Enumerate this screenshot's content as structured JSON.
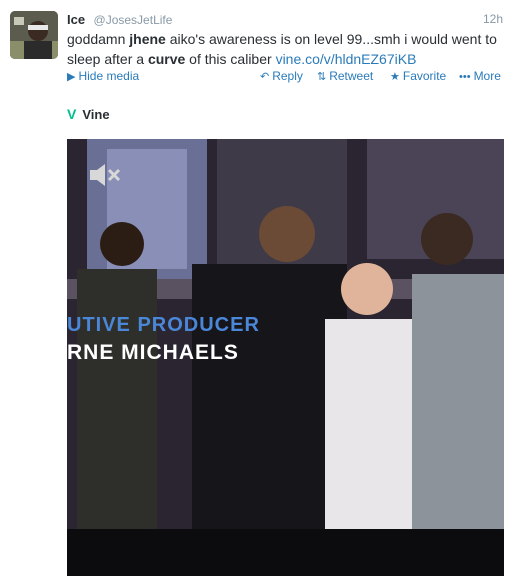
{
  "tweet": {
    "name": "Ice",
    "handle": "@JosesJetLife",
    "time": "12h",
    "text_parts": {
      "t1": "goddamn ",
      "b1": "jhene",
      "t2": " aiko's awareness is on level 99...smh i would went to sleep after a ",
      "b2": "curve",
      "t3": " of this caliber ",
      "link": "vine.co/v/hldnEZ67iKB"
    }
  },
  "actions": {
    "hide_media": "Hide media",
    "reply": "Reply",
    "retweet": "Retweet",
    "favorite": "Favorite",
    "more": "More"
  },
  "card": {
    "source": "Vine"
  },
  "video": {
    "caption_line1": "UTIVE PRODUCER",
    "caption_line2": "RNE MICHAELS"
  },
  "colors": {
    "link": "#2b7bb9",
    "vine": "#00bf8f",
    "caption_blue": "#4a87d8"
  },
  "icons": [
    "video-icon",
    "reply-icon",
    "retweet-icon",
    "favorite-icon",
    "more-icon",
    "vine-icon",
    "mute-icon"
  ]
}
